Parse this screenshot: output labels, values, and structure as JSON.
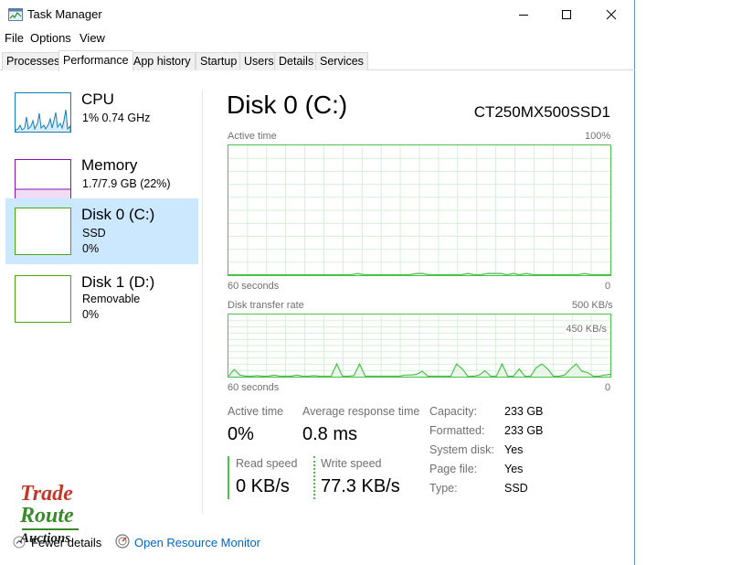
{
  "window": {
    "title": "Task Manager"
  },
  "menu": {
    "file": "File",
    "options": "Options",
    "view": "View"
  },
  "tabs": {
    "processes": "Processes",
    "performance": "Performance",
    "app_history": "App history",
    "startup": "Startup",
    "users": "Users",
    "details": "Details",
    "services": "Services",
    "active": "Performance"
  },
  "sidebar": {
    "items": [
      {
        "name": "CPU",
        "line1": "1%  0.74 GHz",
        "line2": "",
        "color": "#117dbb"
      },
      {
        "name": "Memory",
        "line1": "1.7/7.9 GB (22%)",
        "line2": "",
        "color": "#8b12ae"
      },
      {
        "name": "Disk 0 (C:)",
        "line1": "SSD",
        "line2": "0%",
        "color": "#4da60c",
        "selected": true
      },
      {
        "name": "Disk 1 (D:)",
        "line1": "Removable",
        "line2": "0%",
        "color": "#4da60c"
      }
    ]
  },
  "main": {
    "title": "Disk 0 (C:)",
    "model": "CT250MX500SSD1",
    "graph1": {
      "label": "Active time",
      "max": "100%",
      "time_span": "60 seconds",
      "min": "0"
    },
    "graph2": {
      "label": "Disk transfer rate",
      "max": "500 KB/s",
      "marker": "450 KB/s",
      "time_span": "60 seconds",
      "min": "0"
    }
  },
  "chart_data": [
    {
      "type": "line",
      "series": [
        {
          "values": [
            0,
            0,
            0,
            0,
            0,
            0,
            0,
            0,
            0,
            0,
            0,
            0,
            0,
            0,
            0,
            0,
            0,
            0,
            0,
            0,
            1,
            0,
            0,
            0,
            0,
            0,
            0,
            0,
            0,
            1,
            1,
            0,
            0,
            0,
            0,
            0,
            0,
            1,
            0,
            0,
            1,
            1,
            1,
            0,
            1,
            0,
            1,
            0,
            0,
            0,
            0,
            0,
            0,
            0,
            0,
            1,
            0,
            0,
            0,
            0
          ]
        }
      ],
      "ylim": [
        0,
        100
      ],
      "y_unit": "%",
      "color": "#4cc24c"
    },
    {
      "type": "line",
      "series": [
        {
          "values": [
            0,
            55,
            10,
            0,
            0,
            5,
            0,
            0,
            10,
            0,
            0,
            0,
            10,
            0,
            0,
            5,
            0,
            0,
            0,
            100,
            0,
            0,
            5,
            100,
            0,
            0,
            0,
            0,
            0,
            0,
            0,
            10,
            10,
            15,
            40,
            0,
            0,
            0,
            0,
            0,
            100,
            60,
            0,
            0,
            10,
            45,
            0,
            0,
            100,
            0,
            0,
            60,
            0,
            0,
            70,
            100,
            60,
            0,
            0,
            10,
            60,
            100,
            40,
            30,
            0,
            0,
            10,
            15
          ]
        }
      ],
      "ylim": [
        0,
        500
      ],
      "y_unit": "KB/s",
      "color": "#4cc24c"
    }
  ],
  "stats": {
    "active_time_label": "Active time",
    "active_time_value": "0%",
    "avg_response_label": "Average response time",
    "avg_response_value": "0.8 ms",
    "read_label": "Read speed",
    "read_value": "0 KB/s",
    "write_label": "Write speed",
    "write_value": "77.3 KB/s"
  },
  "properties": [
    {
      "label": "Capacity:",
      "value": "233 GB"
    },
    {
      "label": "Formatted:",
      "value": "233 GB"
    },
    {
      "label": "System disk:",
      "value": "Yes"
    },
    {
      "label": "Page file:",
      "value": "Yes"
    },
    {
      "label": "Type:",
      "value": "SSD"
    }
  ],
  "footer": {
    "fewer_details": "Fewer details",
    "open_resource_monitor": "Open Resource Monitor"
  },
  "watermark": {
    "line1": "Trade",
    "line2": "Route",
    "line3": "Auctions"
  },
  "colors": {
    "accent_link": "#0066cc",
    "selected_bg": "#cce8ff",
    "disk_green": "#4cc24c"
  }
}
